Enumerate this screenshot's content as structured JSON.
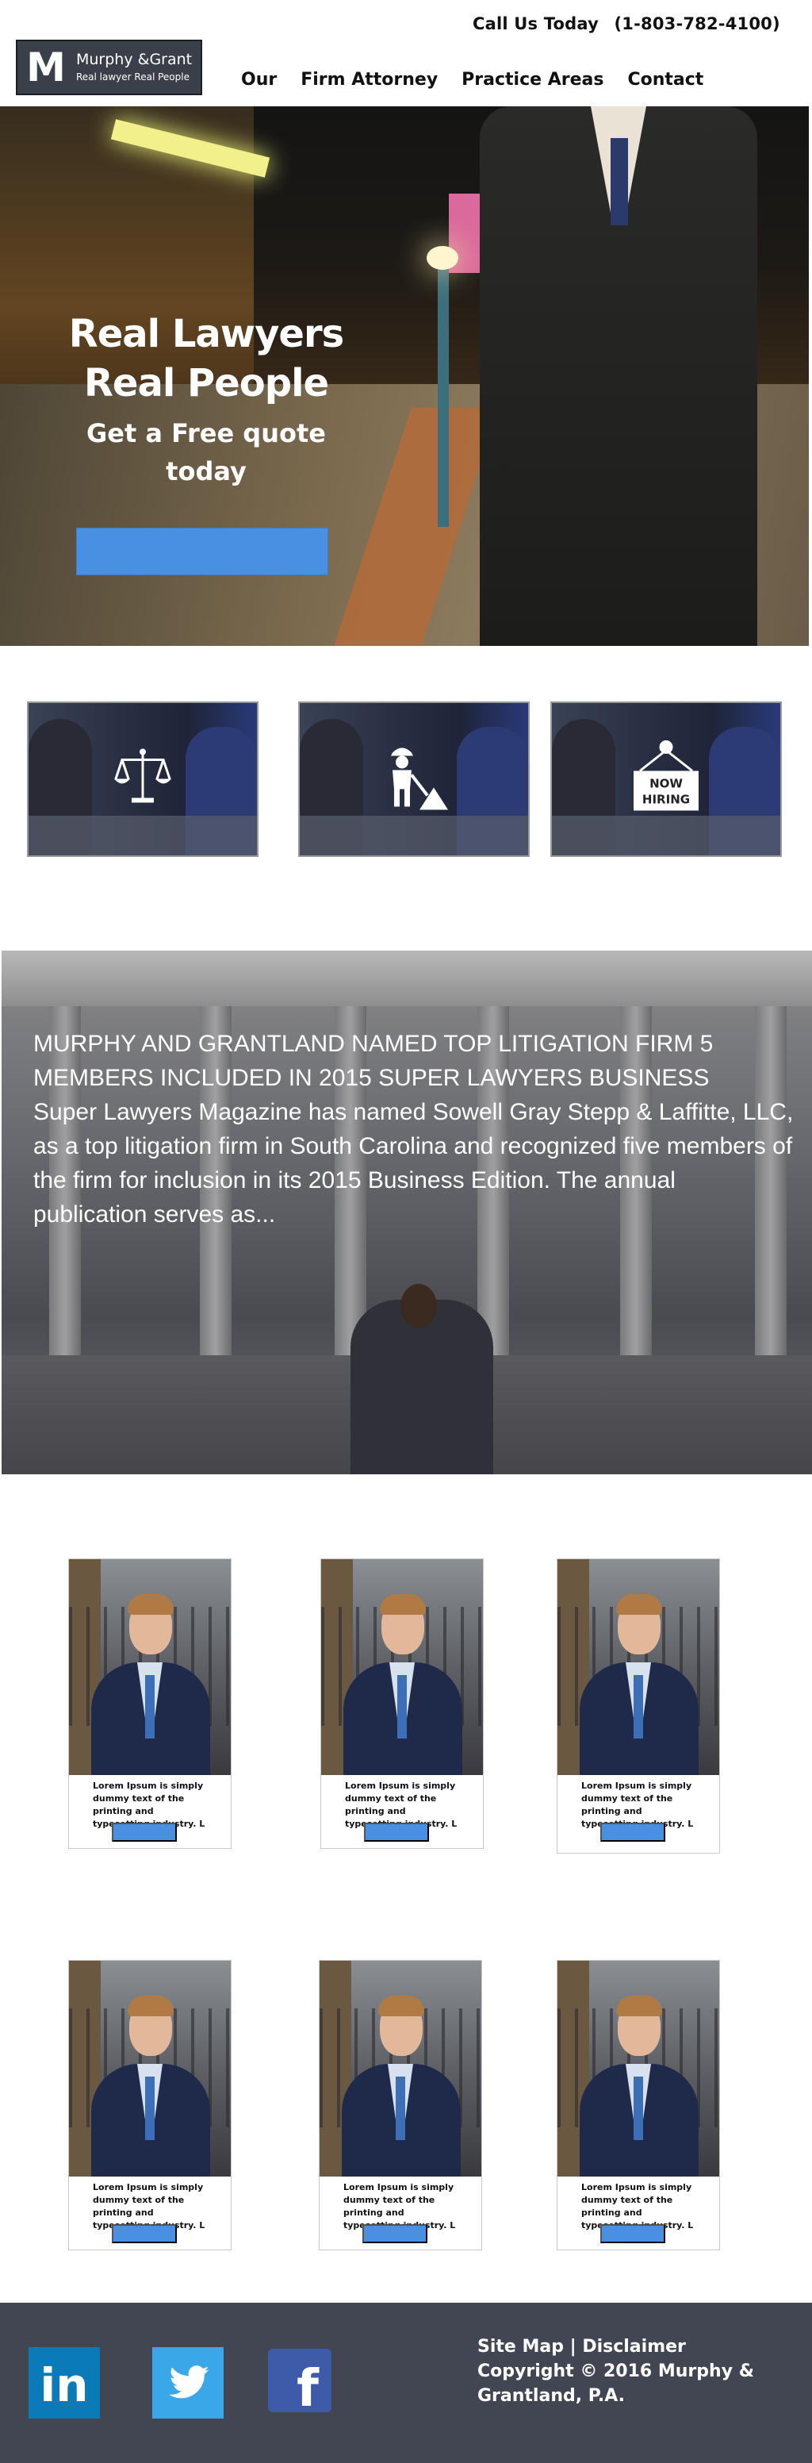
{
  "header": {
    "call_label": "Call Us Today",
    "phone": "(1-803-782-4100)",
    "logo": {
      "letter": "M",
      "name": "Murphy &Grant",
      "tagline": "Real lawyer Real People"
    },
    "nav": [
      "Our",
      "Firm Attorney",
      "Practice Areas",
      "Contact"
    ]
  },
  "hero": {
    "title_line1": "Real Lawyers",
    "title_line2": "Real People",
    "subtitle_line1": "Get a Free quote",
    "subtitle_line2": "today",
    "button_label": ""
  },
  "services": [
    {
      "icon": "scales-of-justice-icon"
    },
    {
      "icon": "construction-worker-icon"
    },
    {
      "icon": "now-hiring-sign-icon",
      "sign_line1": "NOW",
      "sign_line2": "HIRING"
    }
  ],
  "news": {
    "heading": "MURPHY AND GRANTLAND NAMED TOP LITIGATION FIRM 5 MEMBERS INCLUDED IN 2015 SUPER LAWYERS BUSINESS",
    "body": "Super Lawyers Magazine has named Sowell Gray Stepp & Laffitte, LLC, as a top litigation firm in South Carolina and recognized five members of the firm for inclusion in its 2015 Business Edition. The annual publication serves as..."
  },
  "profiles": [
    {
      "text": "Lorem Ipsum is simply dummy text of the printing and typesetting industry. L",
      "button_label": ""
    },
    {
      "text": "Lorem Ipsum is simply dummy text of the printing and typesetting industry. L",
      "button_label": ""
    },
    {
      "text": "Lorem Ipsum is simply dummy text of the printing and typesetting industry. L",
      "button_label": ""
    },
    {
      "text": "Lorem Ipsum is simply dummy text of the printing and typesetting industry. L",
      "button_label": ""
    },
    {
      "text": "Lorem Ipsum is simply dummy text of the printing and typesetting industry. L",
      "button_label": ""
    },
    {
      "text": "Lorem Ipsum is simply dummy text of the printing and typesetting industry. L",
      "button_label": ""
    }
  ],
  "footer": {
    "social": [
      "linkedin-icon",
      "twitter-icon",
      "facebook-icon"
    ],
    "social_labels": {
      "linkedin": "in",
      "facebook": "f"
    },
    "links": "Site Map | Disclaimer",
    "copyright": "Copyright © 2016 Murphy & Grantland, P.A."
  },
  "colors": {
    "accent": "#4a90e2",
    "dark": "#414652",
    "logo_bg": "#3b3f4a",
    "linkedin": "#0a7bb8",
    "twitter": "#3aa7e8",
    "facebook": "#3d5ba9"
  }
}
